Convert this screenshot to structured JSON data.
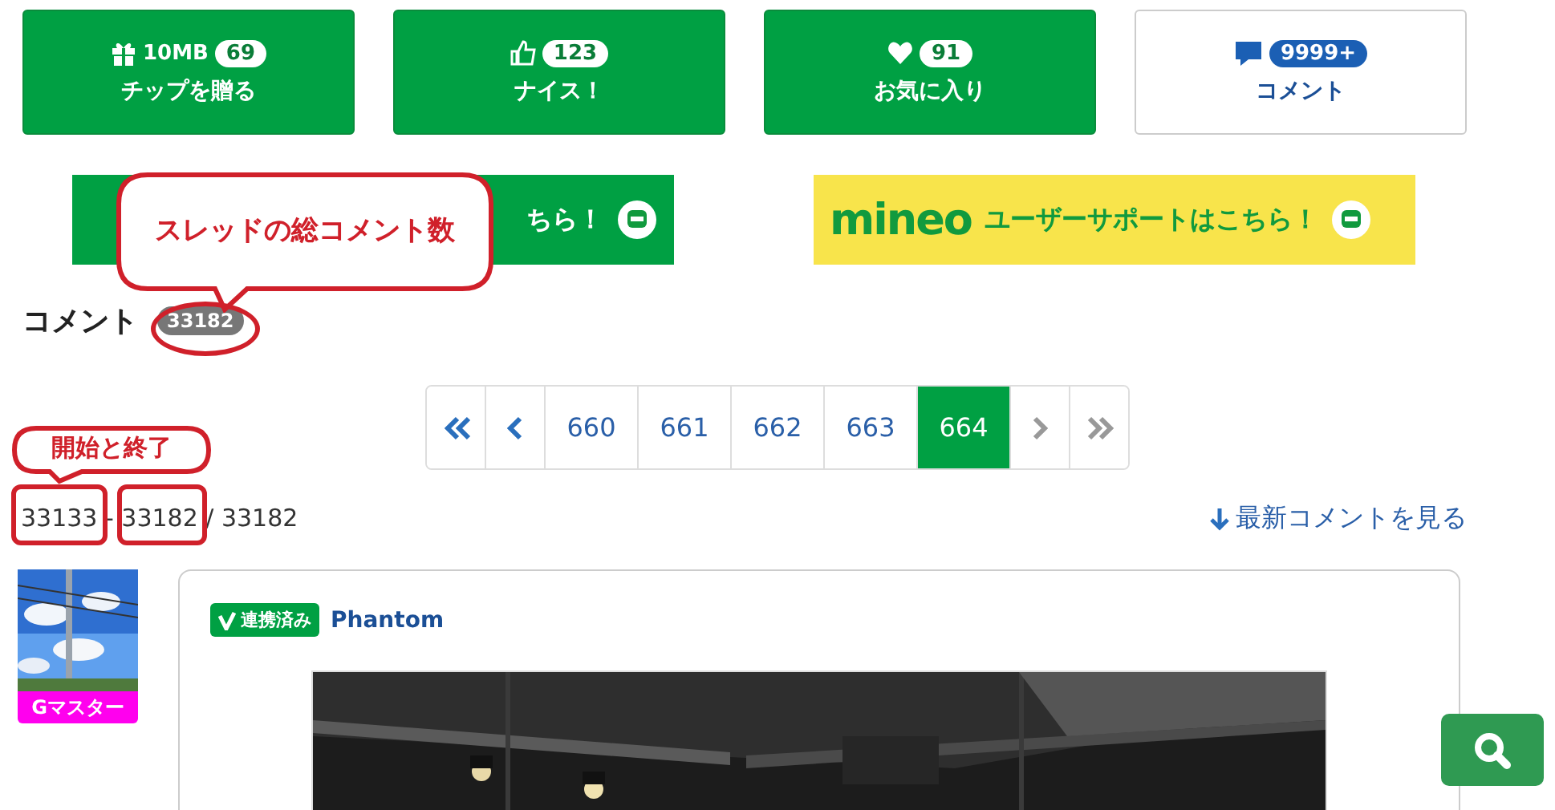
{
  "actions": [
    {
      "kind": "tip",
      "prefix": "10MB",
      "count": "69",
      "label": "チップを贈る"
    },
    {
      "kind": "like",
      "count": "123",
      "label": "ナイス！"
    },
    {
      "kind": "favorite",
      "count": "91",
      "label": "お気に入り"
    },
    {
      "kind": "comment",
      "count": "9999+",
      "label": "コメント"
    }
  ],
  "banners": [
    {
      "kind": "green",
      "text": "ちら！"
    },
    {
      "kind": "yellow",
      "logo": "mineo",
      "text": "ユーザーサポートはこちら！"
    }
  ],
  "comments": {
    "title": "コメント",
    "count": "33182"
  },
  "pagination": [
    {
      "kind": "first",
      "disabled": false
    },
    {
      "kind": "prev",
      "disabled": false
    },
    {
      "kind": "page",
      "label": "660",
      "selected": false
    },
    {
      "kind": "page",
      "label": "661",
      "selected": false
    },
    {
      "kind": "page",
      "label": "662",
      "selected": false
    },
    {
      "kind": "page",
      "label": "663",
      "selected": false
    },
    {
      "kind": "page",
      "label": "664",
      "selected": true
    },
    {
      "kind": "next",
      "disabled": true
    },
    {
      "kind": "last",
      "disabled": true
    }
  ],
  "range": "33133 - 33182 / 33182",
  "latest_link": "最新コメントを見る",
  "comment": {
    "avatar_label": "Gマスター",
    "badge": "連携済み",
    "author": "Phantom"
  },
  "annotations": [
    {
      "kind": "callout",
      "text": "スレッドの総コメント数"
    },
    {
      "kind": "ellipse"
    },
    {
      "kind": "callout",
      "text": "開始と終了"
    },
    {
      "kind": "box"
    },
    {
      "kind": "box"
    }
  ]
}
